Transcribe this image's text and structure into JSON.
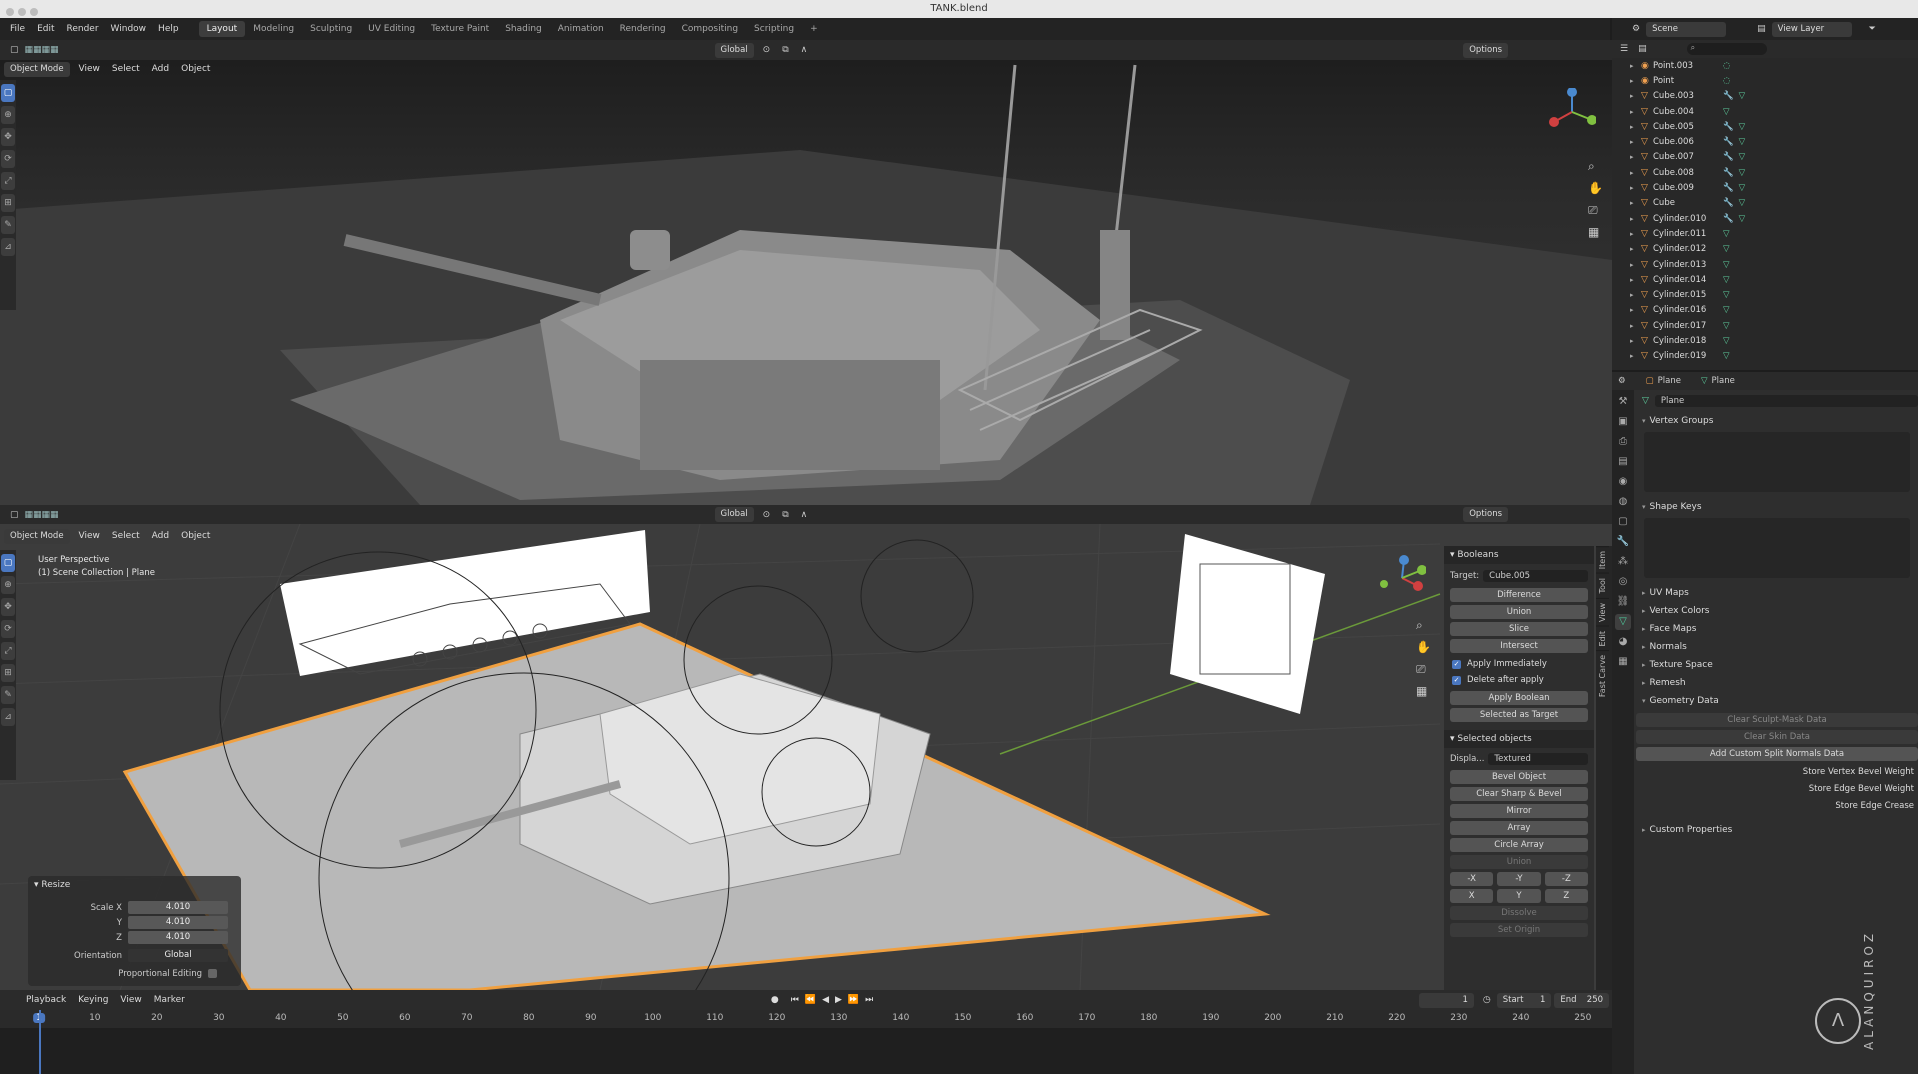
{
  "window": {
    "title": "TANK.blend"
  },
  "menu": [
    "File",
    "Edit",
    "Render",
    "Window",
    "Help"
  ],
  "workspaces": [
    {
      "label": "Layout",
      "active": true
    },
    {
      "label": "Modeling"
    },
    {
      "label": "Sculpting"
    },
    {
      "label": "UV Editing"
    },
    {
      "label": "Texture Paint"
    },
    {
      "label": "Shading"
    },
    {
      "label": "Animation"
    },
    {
      "label": "Rendering"
    },
    {
      "label": "Compositing"
    },
    {
      "label": "Scripting"
    }
  ],
  "add_workspace": "+",
  "scene": {
    "label": "Scene",
    "view_layer": "View Layer"
  },
  "viewport_header": {
    "mode": "Object Mode",
    "menus": [
      "View",
      "Select",
      "Add",
      "Object"
    ],
    "transform": "Global",
    "options": "Options"
  },
  "viewport2": {
    "perspective": "User Perspective",
    "collection": "(1) Scene Collection | Plane"
  },
  "resize_panel": {
    "title": "Resize",
    "scale_x_label": "Scale X",
    "scale_x": "4.010",
    "y_label": "Y",
    "y": "4.010",
    "z_label": "Z",
    "z": "4.010",
    "orientation_label": "Orientation",
    "orientation": "Global",
    "proportional": "Proportional Editing"
  },
  "npanel": {
    "booleans": "Booleans",
    "target_label": "Target:",
    "target": "Cube.005",
    "buttons": [
      "Difference",
      "Union",
      "Slice",
      "Intersect"
    ],
    "apply_immediately": "Apply Immediately",
    "delete_after_apply": "Delete after apply",
    "apply_boolean": "Apply Boolean",
    "selected_as_target": "Selected as Target",
    "selected_objects": "Selected objects",
    "display_label": "Displa...",
    "display_value": "Textured",
    "buttons2": [
      "Bevel Object",
      "Clear Sharp & Bevel",
      "Mirror",
      "Array",
      "Circle Array"
    ],
    "union_disabled": "Union",
    "axes": [
      "-X",
      "-Y",
      "-Z",
      "X",
      "Y",
      "Z"
    ],
    "dissolve": "Dissolve",
    "set_origin": "Set Origin"
  },
  "vtabs": [
    "Item",
    "Tool",
    "View",
    "Edit",
    "Fast Carve"
  ],
  "outliner": [
    {
      "name": "Point.003",
      "type": "light"
    },
    {
      "name": "Point",
      "type": "light"
    },
    {
      "name": "Cube.003",
      "mod": true
    },
    {
      "name": "Cube.004"
    },
    {
      "name": "Cube.005",
      "mod": true
    },
    {
      "name": "Cube.006",
      "mod": true
    },
    {
      "name": "Cube.007",
      "mod": true
    },
    {
      "name": "Cube.008",
      "mod": true
    },
    {
      "name": "Cube.009",
      "mod": true
    },
    {
      "name": "Cube",
      "mod": true
    },
    {
      "name": "Cylinder.010",
      "mod": true
    },
    {
      "name": "Cylinder.011"
    },
    {
      "name": "Cylinder.012"
    },
    {
      "name": "Cylinder.013"
    },
    {
      "name": "Cylinder.014"
    },
    {
      "name": "Cylinder.015"
    },
    {
      "name": "Cylinder.016"
    },
    {
      "name": "Cylinder.017"
    },
    {
      "name": "Cylinder.018"
    },
    {
      "name": "Cylinder.019"
    }
  ],
  "properties": {
    "breadcrumb_object": "Plane",
    "breadcrumb_data": "Plane",
    "mesh_name": "Plane",
    "vertex_groups": "Vertex Groups",
    "shape_keys": "Shape Keys",
    "sections": [
      "UV Maps",
      "Vertex Colors",
      "Face Maps",
      "Normals",
      "Texture Space",
      "Remesh"
    ],
    "geometry_data": "Geometry Data",
    "clear_sculpt": "Clear Sculpt-Mask Data",
    "clear_skin": "Clear Skin Data",
    "add_split_normals": "Add Custom Split Normals Data",
    "store_vertex": "Store Vertex Bevel Weight",
    "store_edge_bevel": "Store Edge Bevel Weight",
    "store_edge_crease": "Store Edge Crease",
    "custom_properties": "Custom Properties"
  },
  "timeline": {
    "menus": [
      "Playback",
      "Keying",
      "View",
      "Marker"
    ],
    "current_frame": "1",
    "start_label": "Start",
    "start": "1",
    "end_label": "End",
    "end": "250",
    "ticks": [
      "1",
      "10",
      "20",
      "30",
      "40",
      "50",
      "60",
      "70",
      "80",
      "90",
      "100",
      "110",
      "120",
      "130",
      "140",
      "150",
      "160",
      "170",
      "180",
      "190",
      "200",
      "210",
      "220",
      "230",
      "240",
      "250"
    ]
  },
  "watermark": "ALANQUIROZ",
  "logo": "Λ",
  "colors": {
    "accent": "#4a77c0",
    "selection": "#f0a040",
    "mesh": "#5ed0a0"
  }
}
